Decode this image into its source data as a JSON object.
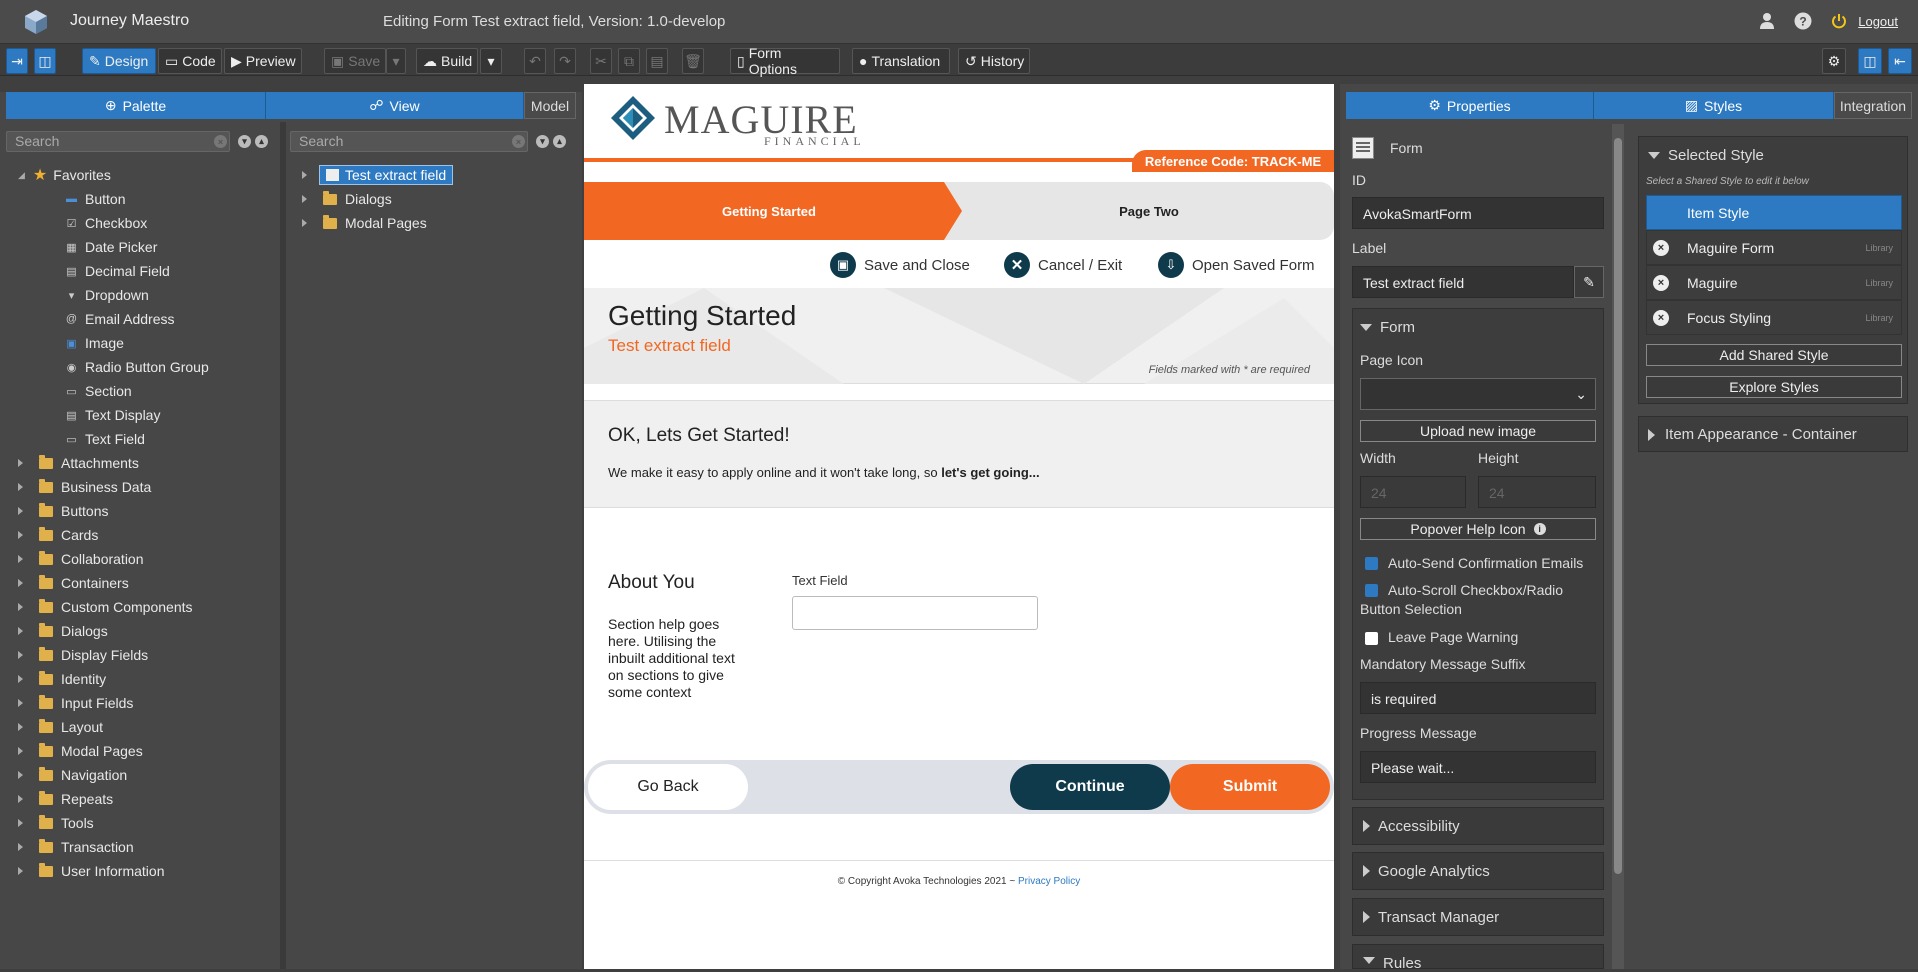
{
  "app": {
    "name": "Journey Maestro",
    "editing_title": "Editing Form Test extract field, Version: 1.0-develop",
    "logout": "Logout"
  },
  "toolbar": {
    "design": "Design",
    "code": "Code",
    "preview": "Preview",
    "save": "Save",
    "build": "Build",
    "form_options": "Form Options",
    "translation": "Translation",
    "history": "History"
  },
  "left": {
    "palette_tab": "Palette",
    "view_tab": "View",
    "model_tab": "Model",
    "search_placeholder": "Search",
    "favorites_label": "Favorites",
    "favorites": [
      "Button",
      "Checkbox",
      "Date Picker",
      "Decimal Field",
      "Dropdown",
      "Email Address",
      "Image",
      "Radio Button Group",
      "Section",
      "Text Display",
      "Text Field"
    ],
    "categories": [
      "Attachments",
      "Business Data",
      "Buttons",
      "Cards",
      "Collaboration",
      "Containers",
      "Custom Components",
      "Dialogs",
      "Display Fields",
      "Identity",
      "Input Fields",
      "Layout",
      "Modal Pages",
      "Navigation",
      "Repeats",
      "Tools",
      "Transaction",
      "User Information"
    ],
    "view_tree": [
      "Test extract field",
      "Dialogs",
      "Modal Pages"
    ]
  },
  "form": {
    "brand": "MAGUIRE",
    "brand_sub": "FINANCIAL",
    "reference": "Reference Code: TRACK-ME",
    "step1": "Getting Started",
    "step2": "Page Two",
    "save_close": "Save and Close",
    "cancel_exit": "Cancel / Exit",
    "open_saved": "Open Saved Form",
    "page_title": "Getting Started",
    "page_subtitle": "Test extract field",
    "required_note": "Fields marked with * are required",
    "intro_title": "OK, Lets Get Started!",
    "intro_text": "We make it easy to apply online and it won't take long, so ",
    "intro_bold": "let's get going...",
    "section_title": "About You",
    "section_help": "Section help goes here. Utilising the inbuilt additional text on sections to give some context",
    "text_field_label": "Text Field",
    "text_field_value": "",
    "go_back": "Go Back",
    "continue": "Continue",
    "submit": "Submit",
    "copyright": "© Copyright Avoka Technologies 2021 ~ ",
    "privacy": "Privacy Policy"
  },
  "properties": {
    "tab_properties": "Properties",
    "tab_styles": "Styles",
    "tab_integration": "Integration",
    "type": "Form",
    "id_label": "ID",
    "id_value": "AvokaSmartForm",
    "label_label": "Label",
    "label_value": "Test extract field",
    "form_section": "Form",
    "page_icon": "Page Icon",
    "page_icon_value": "",
    "upload": "Upload new image",
    "width_label": "Width",
    "height_label": "Height",
    "width_value": "24",
    "height_value": "24",
    "popover": "Popover Help Icon",
    "auto_send": "Auto-Send Confirmation Emails",
    "auto_scroll": "Auto-Scroll Checkbox/Radio Button Selection",
    "leave_warning": "Leave Page Warning",
    "mandatory_label": "Mandatory Message Suffix",
    "mandatory_value": "is required",
    "progress_label": "Progress Message",
    "progress_value": "Please wait...",
    "accessibility": "Accessibility",
    "google_analytics": "Google Analytics",
    "transact_manager": "Transact Manager",
    "rules": "Rules"
  },
  "styles": {
    "selected_title": "Selected Style",
    "hint": "Select a Shared Style to edit it below",
    "item_style": "Item Style",
    "shared": [
      {
        "name": "Maguire Form",
        "tag": "Library"
      },
      {
        "name": "Maguire",
        "tag": "Library"
      },
      {
        "name": "Focus Styling",
        "tag": "Library"
      }
    ],
    "add_shared": "Add Shared Style",
    "explore": "Explore Styles",
    "item_appearance": "Item Appearance - Container"
  },
  "colors": {
    "accent": "#2d7ac2",
    "orange": "#f26722",
    "navy": "#0f3a4c"
  }
}
